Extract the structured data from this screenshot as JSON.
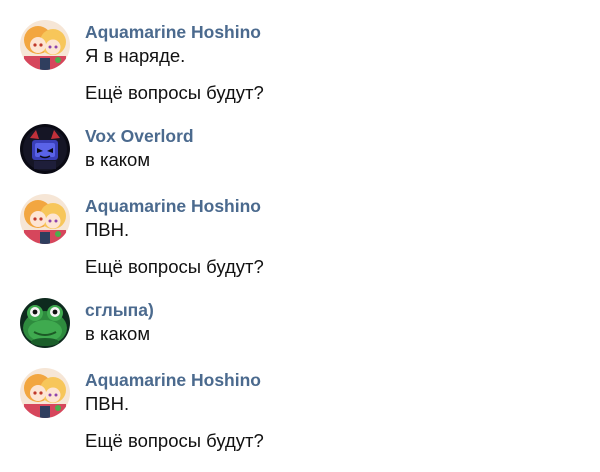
{
  "messages": [
    {
      "author": "Aquamarine Hoshino",
      "avatar_icon": "anime-twins-avatar",
      "lines": [
        "Я в наряде.",
        "Ещё вопросы будут?"
      ]
    },
    {
      "author": "Vox Overlord",
      "avatar_icon": "dark-tv-demon-avatar",
      "lines": [
        "в каком"
      ]
    },
    {
      "author": "Aquamarine Hoshino",
      "avatar_icon": "anime-twins-avatar",
      "lines": [
        "ПВН.",
        "Ещё вопросы будут?"
      ]
    },
    {
      "author": "сглыпа)",
      "avatar_icon": "green-frog-avatar",
      "lines": [
        "в каком"
      ]
    },
    {
      "author": "Aquamarine Hoshino",
      "avatar_icon": "anime-twins-avatar",
      "lines": [
        "ПВН.",
        "Ещё вопросы будут?"
      ]
    }
  ],
  "colors": {
    "author_name": "#4b6a8e",
    "message_text": "#111111",
    "background": "#ffffff"
  }
}
